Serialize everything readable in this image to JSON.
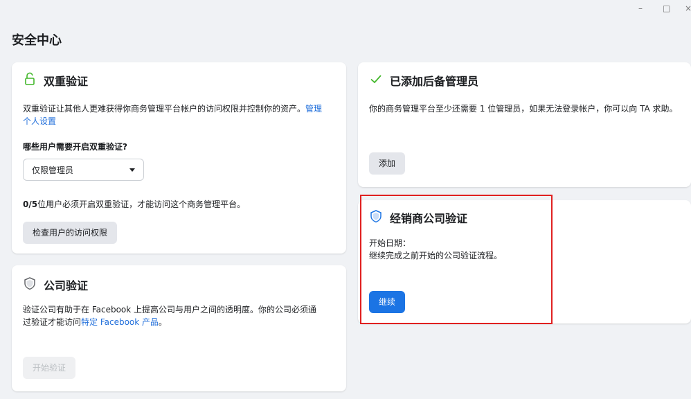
{
  "page": {
    "title": "安全中心"
  },
  "window": {
    "minimize": "–",
    "maximize": "□",
    "close": "×"
  },
  "two_factor": {
    "title": "双重验证",
    "desc_main": "双重验证让其他人更难获得你商务管理平台帐户的访问权限并控制你的资产。",
    "desc_link": "管理个人设置",
    "question": "哪些用户需要开启双重验证?",
    "dropdown_value": "仅限管理员",
    "status_count": "0/5",
    "status_text": "位用户必须开启双重验证，才能访问这个商务管理平台。",
    "button": "检查用户的访问权限"
  },
  "backup_admin": {
    "title": "已添加后备管理员",
    "desc": "你的商务管理平台至少还需要 1 位管理员，如果无法登录帐户，你可以向 TA 求助。",
    "button": "添加"
  },
  "dealer_verify": {
    "title": "经销商公司验证",
    "start_date_label": "开始日期：",
    "desc": "继续完成之前开始的公司验证流程。",
    "button": "继续"
  },
  "company_verify": {
    "title": "公司验证",
    "desc_main": "验证公司有助于在 Facebook 上提高公司与用户之间的透明度。你的公司必须通过验证才能访问",
    "desc_link": "特定 Facebook 产品",
    "desc_end": "。",
    "button": "开始验证"
  },
  "colors": {
    "accent": "#1b74e4",
    "link": "#216fdb",
    "check": "#42b72a",
    "highlight": "#e02020",
    "background": "#f0f2f5"
  },
  "icons": {
    "two_factor": "unlock-icon",
    "backup_admin": "checkmark-icon",
    "dealer": "shield-icon",
    "company": "shield-icon"
  }
}
